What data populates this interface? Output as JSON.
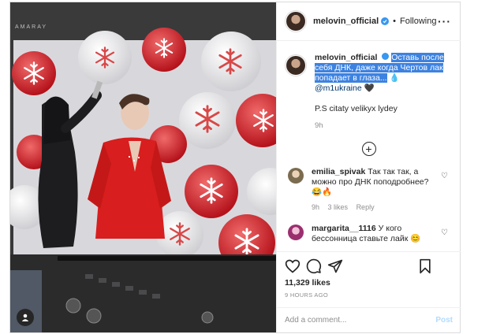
{
  "post": {
    "username": "melovin_official",
    "following_label": "Following",
    "caption": {
      "username": "melovin_official",
      "text_highlighted": "Оставь после себя ДНК, даже когда Чертов лак попадает в глаза...",
      "mention": "@m1ukraine",
      "signature": "P.S citaty velikyx lydey",
      "time": "9h"
    },
    "comments": [
      {
        "username": "emilia_spivak",
        "text": "Так так так, а можно про ДНК поподробнее? 😂🔥",
        "time": "9h",
        "likes": "3 likes",
        "reply_label": "Reply"
      },
      {
        "username": "margarita__1116",
        "text": "У кого бессонница ставьте лайк 😊"
      }
    ],
    "likes_count": "11,329 likes",
    "time_ago": "9 HOURS AGO",
    "add_comment_placeholder": "Add a comment...",
    "post_button": "Post"
  },
  "icons": {
    "verified": "verified-badge-icon",
    "more": "more-options-icon",
    "like": "heart-icon",
    "comment": "comment-icon",
    "share": "share-icon",
    "save": "bookmark-icon",
    "load_more": "plus-circle-icon",
    "tagged_user": "user-tag-icon"
  },
  "colors": {
    "accent": "#3897f0",
    "highlight": "#3d82e0",
    "muted": "#8e8e8e",
    "jacket_red": "#d81e1e"
  },
  "photo": {
    "monitor_brand": "AMARAY"
  }
}
